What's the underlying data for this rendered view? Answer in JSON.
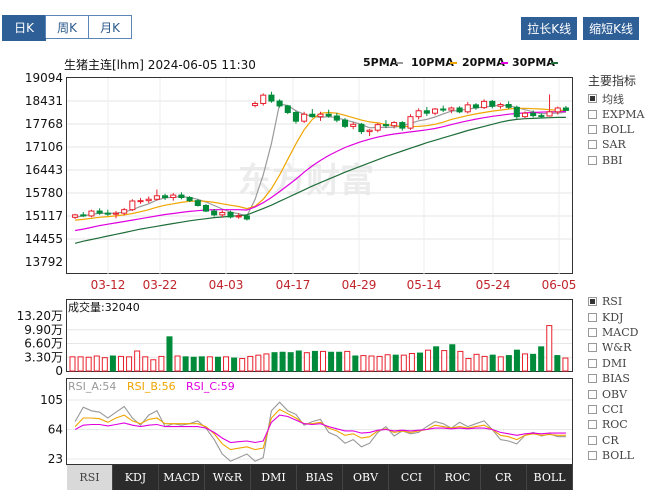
{
  "period_tabs": [
    {
      "label": "日K",
      "active": true
    },
    {
      "label": "周K",
      "active": false
    },
    {
      "label": "月K",
      "active": false
    }
  ],
  "buttons": {
    "stretch": "拉长K线",
    "shrink": "缩短K线"
  },
  "header": {
    "title": "生猪主连[lhm] 2024-06-05 11:30",
    "ma": [
      {
        "label": "5PMA",
        "color": "#9a9a9a"
      },
      {
        "label": "10PMA",
        "color": "#f0a500"
      },
      {
        "label": "20PMA",
        "color": "#e000e0"
      },
      {
        "label": "30PMA",
        "color": "#1f6e3a"
      }
    ]
  },
  "indicators_title": "主要指标",
  "main_indicators": [
    {
      "label": "均线",
      "checked": true
    },
    {
      "label": "EXPMA",
      "checked": false
    },
    {
      "label": "BOLL",
      "checked": false
    },
    {
      "label": "SAR",
      "checked": false
    },
    {
      "label": "BBI",
      "checked": false
    }
  ],
  "sub_indicators": [
    {
      "label": "RSI",
      "checked": true
    },
    {
      "label": "KDJ",
      "checked": false
    },
    {
      "label": "MACD",
      "checked": false
    },
    {
      "label": "W&R",
      "checked": false
    },
    {
      "label": "DMI",
      "checked": false
    },
    {
      "label": "BIAS",
      "checked": false
    },
    {
      "label": "OBV",
      "checked": false
    },
    {
      "label": "CCI",
      "checked": false
    },
    {
      "label": "ROC",
      "checked": false
    },
    {
      "label": "CR",
      "checked": false
    },
    {
      "label": "BOLL",
      "checked": false
    }
  ],
  "bottom_tabs": [
    {
      "label": "RSI",
      "active": true
    },
    {
      "label": "KDJ",
      "active": false
    },
    {
      "label": "MACD",
      "active": false
    },
    {
      "label": "W&R",
      "active": false
    },
    {
      "label": "DMI",
      "active": false
    },
    {
      "label": "BIAS",
      "active": false
    },
    {
      "label": "OBV",
      "active": false
    },
    {
      "label": "CCI",
      "active": false
    },
    {
      "label": "ROC",
      "active": false
    },
    {
      "label": "CR",
      "active": false
    },
    {
      "label": "BOLL",
      "active": false
    }
  ],
  "watermark": "东方财富",
  "chart_data": [
    {
      "type": "candlestick",
      "ylim": [
        13792,
        19094
      ],
      "yticks": [
        "19094",
        "18431",
        "17768",
        "17106",
        "16443",
        "15780",
        "15117",
        "14455",
        "13792"
      ],
      "xticks": [
        "03-12",
        "03-22",
        "04-03",
        "04-17",
        "04-29",
        "05-14",
        "05-24",
        "06-05"
      ],
      "up_color": "#e8212d",
      "down_color": "#008b3a",
      "candles": [
        [
          15080,
          15180,
          15030,
          15150
        ],
        [
          15150,
          15230,
          15090,
          15120
        ],
        [
          15120,
          15300,
          15080,
          15260
        ],
        [
          15260,
          15340,
          15150,
          15200
        ],
        [
          15200,
          15300,
          15120,
          15170
        ],
        [
          15170,
          15260,
          15050,
          15200
        ],
        [
          15200,
          15350,
          15140,
          15300
        ],
        [
          15300,
          15600,
          15260,
          15550
        ],
        [
          15550,
          15640,
          15470,
          15560
        ],
        [
          15560,
          15680,
          15490,
          15600
        ],
        [
          15600,
          15880,
          15560,
          15700
        ],
        [
          15700,
          15760,
          15580,
          15650
        ],
        [
          15650,
          15780,
          15560,
          15720
        ],
        [
          15720,
          15800,
          15600,
          15650
        ],
        [
          15650,
          15690,
          15520,
          15560
        ],
        [
          15560,
          15600,
          15390,
          15420
        ],
        [
          15420,
          15460,
          15230,
          15260
        ],
        [
          15260,
          15320,
          15100,
          15150
        ],
        [
          15150,
          15280,
          15080,
          15220
        ],
        [
          15220,
          15270,
          15050,
          15090
        ],
        [
          15090,
          15200,
          15040,
          15120
        ],
        [
          15120,
          15160,
          14990,
          15030
        ],
        [
          18300,
          18420,
          18250,
          18360
        ],
        [
          18360,
          18650,
          18300,
          18600
        ],
        [
          18600,
          18700,
          18380,
          18430
        ],
        [
          18430,
          18480,
          18240,
          18290
        ],
        [
          18290,
          18320,
          18050,
          18100
        ],
        [
          18100,
          18150,
          17780,
          17850
        ],
        [
          17850,
          18120,
          17800,
          18050
        ],
        [
          18050,
          18200,
          17950,
          17980
        ],
        [
          17980,
          18120,
          17860,
          18050
        ],
        [
          18050,
          18180,
          17950,
          18000
        ],
        [
          18000,
          18090,
          17820,
          17880
        ],
        [
          17880,
          17940,
          17650,
          17700
        ],
        [
          17700,
          17820,
          17620,
          17760
        ],
        [
          17760,
          17800,
          17480,
          17550
        ],
        [
          17550,
          17620,
          17420,
          17590
        ],
        [
          17590,
          17800,
          17530,
          17750
        ],
        [
          17750,
          17880,
          17650,
          17720
        ],
        [
          17720,
          17850,
          17640,
          17810
        ],
        [
          17810,
          17850,
          17580,
          17650
        ],
        [
          17650,
          18050,
          17600,
          17980
        ],
        [
          17980,
          18220,
          17900,
          18150
        ],
        [
          18150,
          18260,
          18000,
          18080
        ],
        [
          18080,
          18230,
          18020,
          18200
        ],
        [
          18200,
          18300,
          18110,
          18170
        ],
        [
          18170,
          18270,
          18080,
          18230
        ],
        [
          18230,
          18280,
          18080,
          18120
        ],
        [
          18120,
          18400,
          18070,
          18320
        ],
        [
          18320,
          18370,
          18180,
          18240
        ],
        [
          18240,
          18480,
          18200,
          18420
        ],
        [
          18420,
          18460,
          18220,
          18280
        ],
        [
          18280,
          18380,
          18210,
          18330
        ],
        [
          18330,
          18420,
          18200,
          18250
        ],
        [
          18250,
          18300,
          17920,
          17980
        ],
        [
          17980,
          18130,
          17940,
          18080
        ],
        [
          18080,
          18160,
          17960,
          18010
        ],
        [
          18010,
          18080,
          17930,
          18000
        ],
        [
          18000,
          18620,
          17980,
          18120
        ],
        [
          18120,
          18270,
          18040,
          18230
        ],
        [
          18230,
          18290,
          18140,
          18160
        ]
      ],
      "ma_lines": [
        {
          "name": "5PMA",
          "color": "#9a9a9a",
          "values": [
            15080,
            15120,
            15160,
            15200,
            15190,
            15200,
            15230,
            15300,
            15390,
            15470,
            15580,
            15640,
            15660,
            15680,
            15650,
            15600,
            15520,
            15420,
            15320,
            15230,
            15180,
            15120,
            15600,
            16300,
            17200,
            18350,
            18300,
            18150,
            18050,
            17990,
            17960,
            17980,
            17950,
            17880,
            17830,
            17750,
            17660,
            17670,
            17670,
            17680,
            17710,
            17790,
            17860,
            17900,
            17970,
            18060,
            18140,
            18160,
            18200,
            18230,
            18260,
            18280,
            18310,
            18300,
            18240,
            18180,
            18120,
            18060,
            18080,
            18080,
            18110
          ]
        },
        {
          "name": "10PMA",
          "color": "#f0a500",
          "values": [
            15000,
            15020,
            15050,
            15080,
            15100,
            15120,
            15150,
            15190,
            15240,
            15300,
            15370,
            15430,
            15470,
            15510,
            15540,
            15550,
            15540,
            15510,
            15470,
            15430,
            15390,
            15330,
            15400,
            15600,
            15900,
            16300,
            16750,
            17200,
            17600,
            17900,
            18080,
            18100,
            18080,
            18020,
            17950,
            17880,
            17830,
            17800,
            17760,
            17720,
            17700,
            17690,
            17700,
            17720,
            17760,
            17820,
            17900,
            17960,
            18010,
            18060,
            18100,
            18140,
            18170,
            18200,
            18220,
            18220,
            18210,
            18200,
            18180,
            18170,
            18160
          ]
        },
        {
          "name": "20PMA",
          "color": "#e000e0",
          "values": [
            14700,
            14740,
            14790,
            14840,
            14880,
            14920,
            14960,
            15000,
            15040,
            15080,
            15120,
            15160,
            15190,
            15220,
            15250,
            15270,
            15290,
            15300,
            15300,
            15300,
            15300,
            15290,
            15380,
            15500,
            15650,
            15820,
            16000,
            16180,
            16380,
            16560,
            16720,
            16860,
            16980,
            17090,
            17180,
            17260,
            17330,
            17390,
            17440,
            17480,
            17510,
            17540,
            17570,
            17600,
            17640,
            17690,
            17750,
            17810,
            17860,
            17910,
            17950,
            17990,
            18020,
            18050,
            18070,
            18090,
            18100,
            18110,
            18120,
            18120,
            18130
          ]
        },
        {
          "name": "30PMA",
          "color": "#1f6e3a",
          "values": [
            14330,
            14390,
            14440,
            14490,
            14540,
            14590,
            14640,
            14690,
            14740,
            14780,
            14820,
            14860,
            14900,
            14940,
            14980,
            15010,
            15040,
            15070,
            15090,
            15110,
            15130,
            15150,
            15240,
            15330,
            15430,
            15540,
            15650,
            15760,
            15870,
            15980,
            16080,
            16180,
            16280,
            16380,
            16470,
            16560,
            16650,
            16740,
            16830,
            16910,
            16990,
            17070,
            17150,
            17230,
            17300,
            17370,
            17440,
            17510,
            17580,
            17640,
            17700,
            17760,
            17820,
            17870,
            17900,
            17920,
            17930,
            17940,
            17950,
            17960,
            17960
          ]
        }
      ]
    },
    {
      "type": "bar",
      "title": "成交量:32040",
      "ylim": [
        0,
        132000
      ],
      "yticks": [
        "13.20万",
        "9.90万",
        "6.60万",
        "3.30万",
        "0"
      ],
      "values": [
        34000,
        34000,
        33000,
        36000,
        32000,
        36000,
        35000,
        34000,
        48000,
        34000,
        27000,
        35000,
        82000,
        36000,
        34000,
        33000,
        34000,
        34000,
        33000,
        34000,
        31000,
        30000,
        35000,
        38000,
        41000,
        44000,
        45000,
        44000,
        48000,
        44000,
        47000,
        47000,
        45000,
        45000,
        47000,
        36000,
        37000,
        36000,
        35000,
        39000,
        38000,
        38000,
        42000,
        43000,
        50000,
        58000,
        49000,
        63000,
        47000,
        30000,
        40000,
        35000,
        38000,
        34000,
        37000,
        50000,
        41000,
        40000,
        58000,
        109000,
        37000,
        31000
      ],
      "up": [
        1,
        1,
        1,
        1,
        1,
        0,
        1,
        1,
        1,
        1,
        1,
        1,
        0,
        1,
        0,
        0,
        0,
        1,
        0,
        1,
        0,
        1,
        1,
        1,
        1,
        0,
        0,
        0,
        0,
        1,
        0,
        1,
        0,
        0,
        1,
        0,
        1,
        1,
        1,
        1,
        0,
        1,
        1,
        0,
        1,
        0,
        1,
        0,
        1,
        1,
        1,
        1,
        0,
        1,
        0,
        0,
        1,
        0,
        0,
        1,
        0,
        1
      ]
    },
    {
      "type": "line",
      "ylim": [
        10,
        110
      ],
      "yticks": [
        "105",
        "64",
        "23"
      ],
      "legend": [
        {
          "name": "RSI_A:54",
          "color": "#999999"
        },
        {
          "name": "RSI_B:56",
          "color": "#f0a500"
        },
        {
          "name": "RSI_C:59",
          "color": "#e000e0"
        }
      ],
      "series": [
        {
          "name": "RSI_A",
          "color": "#999999",
          "values": [
            75,
            95,
            90,
            88,
            80,
            88,
            96,
            80,
            70,
            84,
            90,
            68,
            72,
            70,
            72,
            76,
            66,
            50,
            30,
            20,
            25,
            30,
            20,
            25,
            90,
            102,
            90,
            85,
            70,
            75,
            78,
            60,
            55,
            45,
            50,
            40,
            45,
            60,
            68,
            55,
            62,
            58,
            60,
            68,
            75,
            72,
            66,
            74,
            68,
            72,
            76,
            64,
            50,
            48,
            44,
            56,
            60,
            55,
            58,
            54,
            54
          ]
        },
        {
          "name": "RSI_B",
          "color": "#f0a500",
          "values": [
            68,
            80,
            80,
            79,
            74,
            80,
            84,
            76,
            72,
            78,
            80,
            72,
            72,
            72,
            72,
            72,
            68,
            58,
            44,
            36,
            38,
            40,
            36,
            38,
            80,
            92,
            86,
            80,
            72,
            72,
            74,
            66,
            62,
            56,
            58,
            52,
            54,
            62,
            65,
            60,
            62,
            60,
            62,
            64,
            70,
            68,
            66,
            68,
            66,
            68,
            70,
            64,
            56,
            54,
            50,
            56,
            58,
            56,
            57,
            56,
            56
          ]
        },
        {
          "name": "RSI_C",
          "color": "#e000e0",
          "values": [
            64,
            70,
            71,
            71,
            69,
            71,
            73,
            70,
            68,
            70,
            71,
            68,
            68,
            68,
            68,
            68,
            66,
            60,
            52,
            46,
            47,
            48,
            46,
            48,
            74,
            84,
            82,
            77,
            72,
            71,
            72,
            68,
            65,
            62,
            62,
            59,
            60,
            63,
            64,
            62,
            63,
            62,
            63,
            64,
            66,
            66,
            65,
            66,
            65,
            66,
            66,
            64,
            60,
            58,
            56,
            58,
            59,
            58,
            59,
            59,
            59
          ]
        }
      ]
    }
  ]
}
